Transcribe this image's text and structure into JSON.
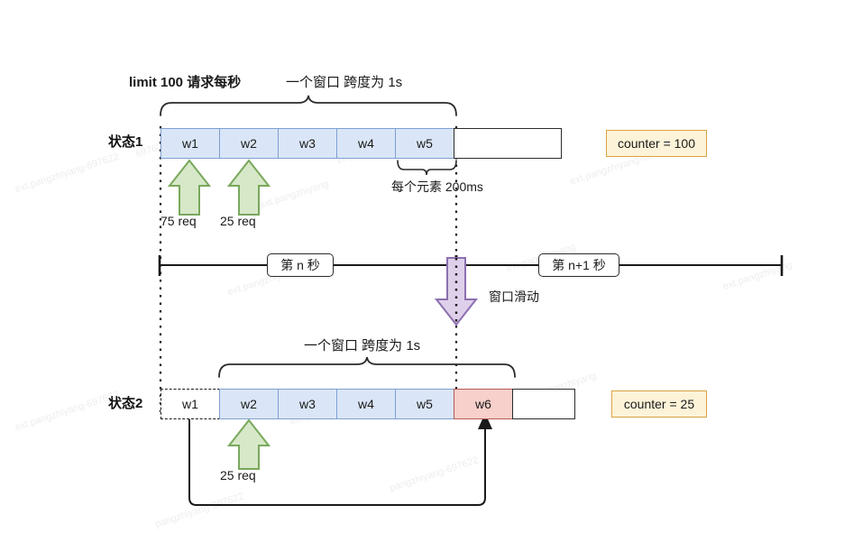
{
  "diagram": {
    "title_limit": "limit 100 请求每秒",
    "window_span_top": "一个窗口 跨度为 1s",
    "window_span_bottom": "一个窗口 跨度为 1s",
    "element_duration": "每个元素 200ms",
    "slide_label": "窗口滑动",
    "state1_label": "状态1",
    "state2_label": "状态2",
    "req_75": "75 req",
    "req_25_top": "25 req",
    "req_25_bottom": "25 req",
    "counter_top": "counter = 100",
    "counter_bottom": "counter = 25",
    "second_n": "第 n 秒",
    "second_n_plus_1": "第 n+1 秒"
  },
  "state1": {
    "cells": [
      {
        "label": "w1",
        "kind": "blue"
      },
      {
        "label": "w2",
        "kind": "blue"
      },
      {
        "label": "w3",
        "kind": "blue"
      },
      {
        "label": "w4",
        "kind": "blue"
      },
      {
        "label": "w5",
        "kind": "blue"
      },
      {
        "label": "",
        "kind": "white"
      }
    ]
  },
  "state2": {
    "cells": [
      {
        "label": "w1",
        "kind": "dashed"
      },
      {
        "label": "w2",
        "kind": "blue"
      },
      {
        "label": "w3",
        "kind": "blue"
      },
      {
        "label": "w4",
        "kind": "blue"
      },
      {
        "label": "w5",
        "kind": "blue"
      },
      {
        "label": "w6",
        "kind": "red"
      },
      {
        "label": "",
        "kind": "white"
      }
    ]
  },
  "colors": {
    "cell_blue_fill": "#dae6f7",
    "cell_blue_stroke": "#7f9fd0",
    "cell_red_fill": "#f7cfcb",
    "cell_red_stroke": "#b55a52",
    "counter_fill": "#fdf3d8",
    "counter_stroke": "#d9a441",
    "green_arrow_fill": "#d7e8c8",
    "green_arrow_stroke": "#79a85c",
    "purple_arrow_fill": "#ded0ea",
    "purple_arrow_stroke": "#8d6fb0",
    "line": "#1a1a1a"
  }
}
